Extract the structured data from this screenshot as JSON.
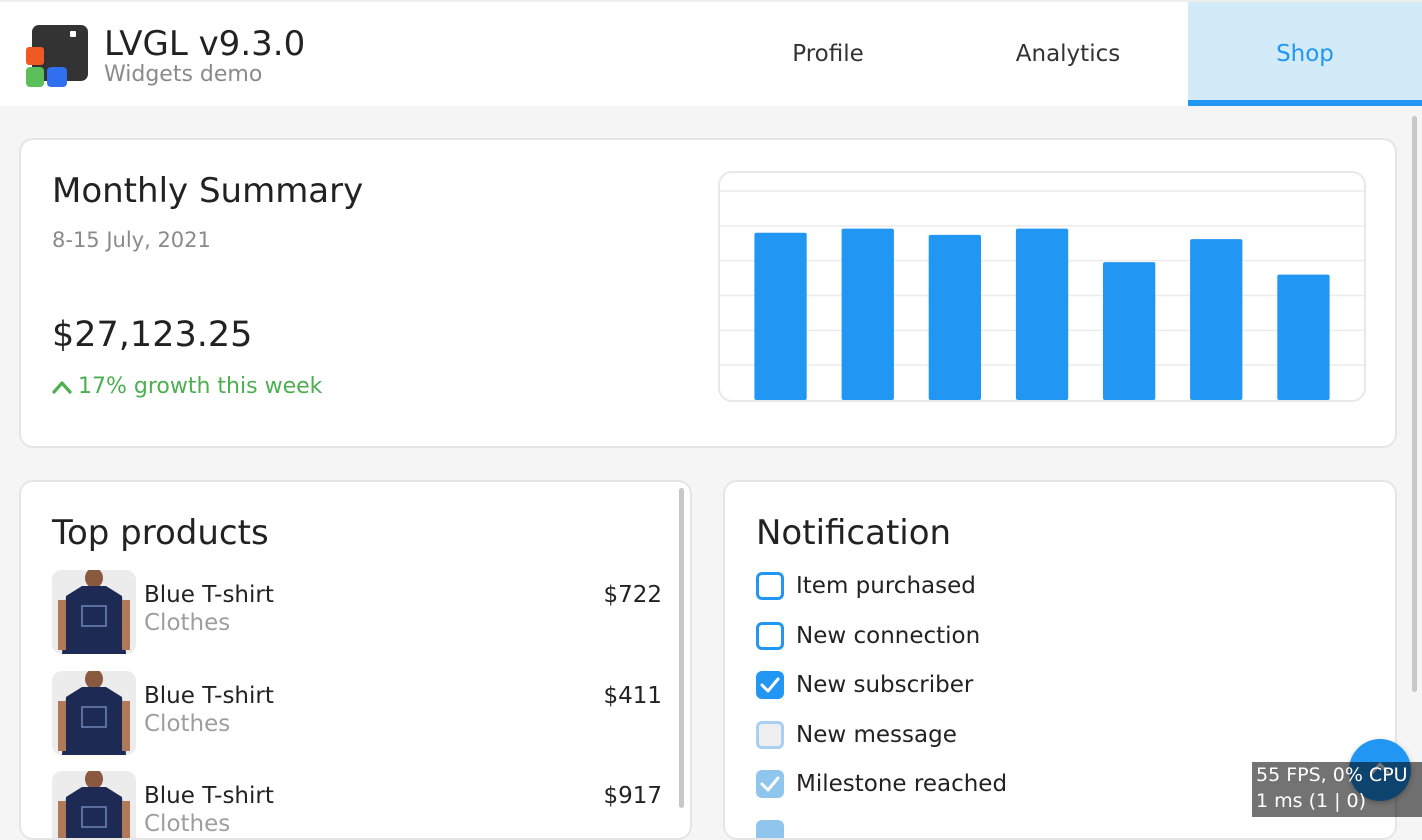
{
  "header": {
    "title": "LVGL v9.3.0",
    "subtitle": "Widgets demo",
    "tabs": [
      {
        "label": "Profile",
        "active": false
      },
      {
        "label": "Analytics",
        "active": false
      },
      {
        "label": "Shop",
        "active": true
      }
    ]
  },
  "summary": {
    "title": "Monthly Summary",
    "date_range": "8-15 July, 2021",
    "amount": "$27,123.25",
    "growth": "17% growth this week",
    "growth_color": "#4caf50"
  },
  "chart_data": {
    "type": "bar",
    "categories": [
      "",
      "",
      "",
      "",
      "",
      "",
      ""
    ],
    "values": [
      80,
      82,
      79,
      82,
      66,
      77,
      60
    ],
    "ylim": [
      0,
      100
    ],
    "grid": true,
    "color": "#2196f3"
  },
  "products": {
    "title": "Top products",
    "items": [
      {
        "name": "Blue T-shirt",
        "category": "Clothes",
        "price": "$722"
      },
      {
        "name": "Blue T-shirt",
        "category": "Clothes",
        "price": "$411"
      },
      {
        "name": "Blue T-shirt",
        "category": "Clothes",
        "price": "$917"
      }
    ]
  },
  "notifications": {
    "title": "Notification",
    "items": [
      {
        "label": "Item purchased",
        "checked": false,
        "disabled": false
      },
      {
        "label": "New connection",
        "checked": false,
        "disabled": false
      },
      {
        "label": "New subscriber",
        "checked": true,
        "disabled": false
      },
      {
        "label": "New message",
        "checked": false,
        "disabled": true
      },
      {
        "label": "Milestone reached",
        "checked": true,
        "disabled": true
      }
    ]
  },
  "perf": {
    "line1": "55 FPS, 0% CPU",
    "line2": "1 ms (1 | 0)"
  },
  "colors": {
    "accent": "#2196f3",
    "tab_active_bg": "#d3eaf8",
    "background": "#f5f5f5"
  },
  "icons": {
    "logo": "lvgl-logo-icon",
    "growth": "chevron-up-icon",
    "fab": "arrow-up-icon",
    "checkbox": "check-icon"
  }
}
